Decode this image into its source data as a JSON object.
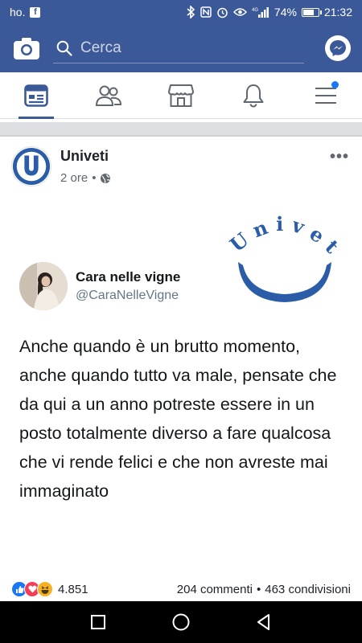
{
  "status_bar": {
    "carrier": "ho.",
    "battery_percent": "74%",
    "battery_level": 0.74,
    "time": "21:32",
    "network": "4G"
  },
  "top_bar": {
    "search_placeholder": "Cerca"
  },
  "nav": {
    "tabs": [
      "news-feed",
      "friends",
      "marketplace",
      "notifications",
      "menu"
    ],
    "active": "news-feed"
  },
  "post": {
    "page_name": "Univeti",
    "time": "2 ore",
    "more": "•••",
    "logo_text": "Univeti",
    "tweet": {
      "name": "Cara nelle vigne",
      "handle": "@CaraNelleVigne",
      "text": "Anche quando è un brutto momento, anche quando tutto va male, pensate che da qui a un anno potreste essere in un posto totalmente diverso a fare qualcosa che vi rende felici e che non avreste mai immaginato"
    },
    "reactions_count": "4.851",
    "comments": "204 commenti",
    "shares_separator": "•",
    "shares": "463 condivisioni"
  },
  "colors": {
    "brand": "#3b5998",
    "logo_blue": "#2b5ca8"
  }
}
